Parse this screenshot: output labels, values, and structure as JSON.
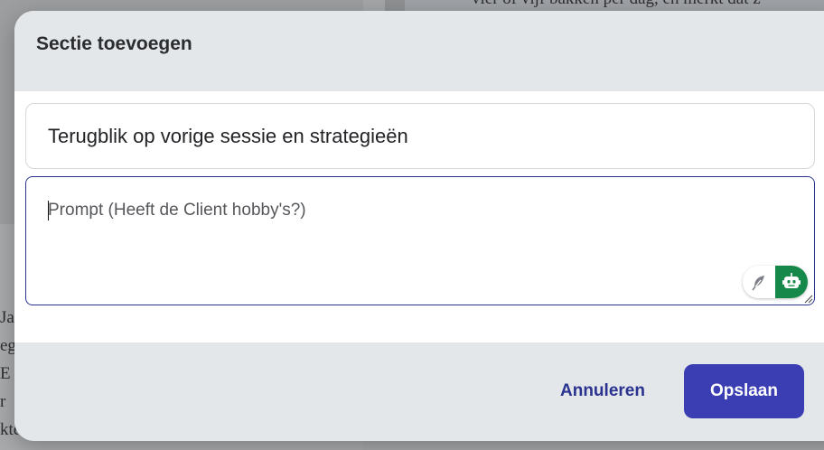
{
  "background": {
    "top_line": "vier of vijf bakken per dag, en merkt dat z",
    "left_lines": [
      "Ja",
      "eg",
      "E",
      "r",
      "kte"
    ]
  },
  "modal": {
    "title": "Sectie toevoegen",
    "section_title_value": "Terugblik op vorige sessie en strategieën",
    "prompt_placeholder": "Prompt (Heeft de Client hobby's?)",
    "icons": {
      "feather": "feather-icon",
      "robot": "robot-icon"
    },
    "accent_color": "#3b3eb3",
    "ai_color": "#16884a"
  },
  "footer": {
    "cancel_label": "Annuleren",
    "save_label": "Opslaan"
  }
}
